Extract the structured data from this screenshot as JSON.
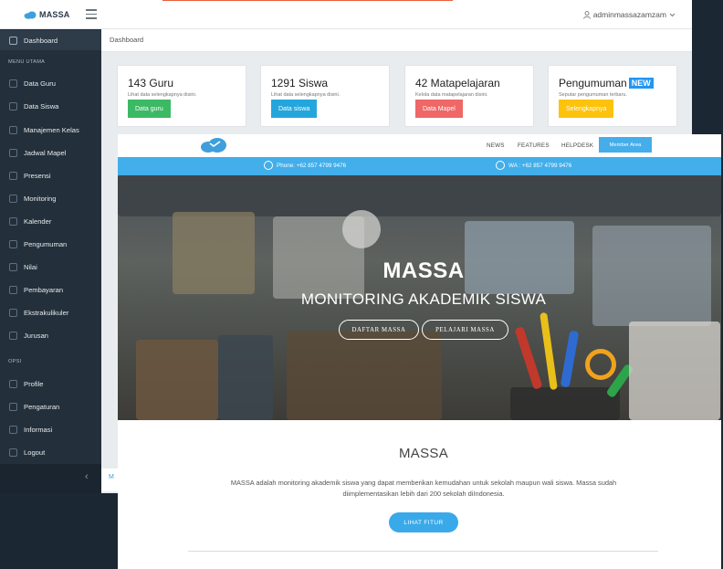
{
  "dashboard": {
    "brand": "MASSA",
    "user": "adminmassazamzam",
    "breadcrumb": "Dashboard",
    "footer_peek": "M",
    "sidebar": {
      "items": [
        {
          "label": "Dashboard",
          "icon": "home-icon"
        },
        {
          "label": "Data Guru",
          "icon": "user-icon"
        },
        {
          "label": "Data Siswa",
          "icon": "users-icon"
        },
        {
          "label": "Manajemen Kelas",
          "icon": "class-icon"
        },
        {
          "label": "Jadwal Mapel",
          "icon": "schedule-icon"
        },
        {
          "label": "Presensi",
          "icon": "pencil-icon"
        },
        {
          "label": "Monitoring",
          "icon": "monitor-icon"
        },
        {
          "label": "Kalender",
          "icon": "calendar-icon"
        },
        {
          "label": "Pengumuman",
          "icon": "megaphone-icon"
        },
        {
          "label": "Nilai",
          "icon": "grade-icon"
        },
        {
          "label": "Pembayaran",
          "icon": "card-icon"
        },
        {
          "label": "Ekstrakulikuler",
          "icon": "activity-icon"
        },
        {
          "label": "Jurusan",
          "icon": "branch-icon"
        }
      ],
      "section_menu": "MENU UTAMA",
      "section_options": "OPSI",
      "options": [
        {
          "label": "Profile",
          "icon": "profile-icon"
        },
        {
          "label": "Pengaturan",
          "icon": "gear-icon"
        },
        {
          "label": "Informasi",
          "icon": "info-icon"
        },
        {
          "label": "Logout",
          "icon": "logout-icon"
        }
      ],
      "collapse_glyph": "‹"
    },
    "cards": [
      {
        "title": "143 Guru",
        "sub": "Lihat data selengkapnya disini.",
        "button": "Data guru",
        "color": "#3cb964"
      },
      {
        "title": "1291 Siswa",
        "sub": "Lihat data selengkapnya disini.",
        "button": "Data siswa",
        "color": "#24a6dd"
      },
      {
        "title": "42 Matapelajaran",
        "sub": "Kelola data matapelajaran disini.",
        "button": "Data Mapel",
        "color": "#ef6767"
      },
      {
        "title": "Pengumuman",
        "badge": "NEW",
        "sub": "Seputar pengumuman terbaru.",
        "button": "Selengkapnya",
        "color": "#fdc20c"
      }
    ]
  },
  "landing": {
    "nav": {
      "news": "NEWS",
      "features": "FEATURES",
      "helpdesk": "HELPDESK",
      "member": "Member Area"
    },
    "contact": {
      "phone": "Phone: +62 857 4799 9476",
      "wa": "WA : +62 857 4799 9476"
    },
    "hero": {
      "title": "MASSA",
      "subtitle": "MONITORING AKADEMIK SISWA",
      "btn1": "DAFTAR MASSA",
      "btn2": "PELAJARI MASSA"
    },
    "section": {
      "title": "MASSA",
      "desc": "MASSA adalah monitoring akademik siswa yang dapat memberikan kemudahan untuk sekolah maupun wali siswa. Massa sudah diimplementasikan lebih dari 200 sekolah diIndonesia.",
      "button": "LIHAT FITUR"
    }
  },
  "colors": {
    "accent": "#42aeea",
    "sidebar": "#232f3a"
  }
}
